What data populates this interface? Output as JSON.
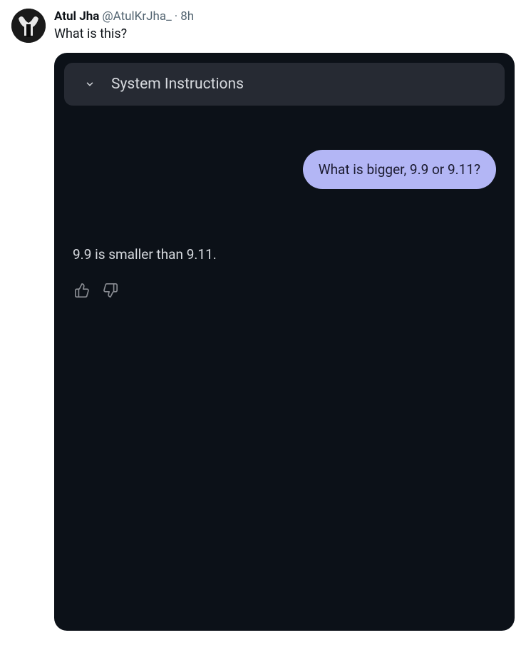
{
  "tweet": {
    "display_name": "Atul Jha",
    "handle": "@AtulKrJha_",
    "separator": "·",
    "time": "8h",
    "text": "What is this?"
  },
  "chat": {
    "system_header": "System Instructions",
    "user_message": "What is bigger, 9.9 or 9.11?",
    "assistant_message": "9.9 is smaller than 9.11."
  }
}
